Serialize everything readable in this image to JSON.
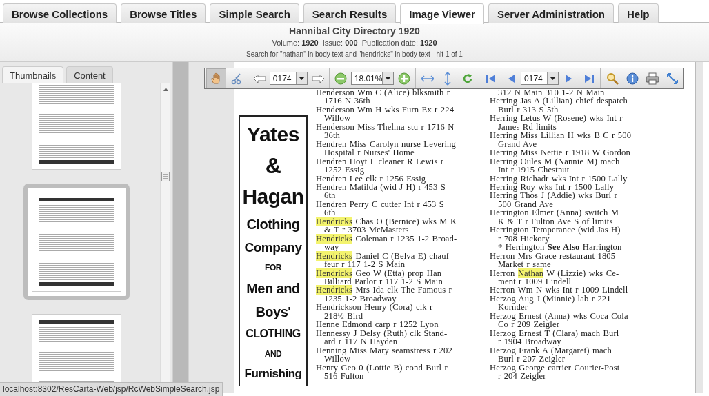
{
  "tabs": [
    {
      "label": "Browse Collections",
      "selected": false
    },
    {
      "label": "Browse Titles",
      "selected": false
    },
    {
      "label": "Simple Search",
      "selected": false
    },
    {
      "label": "Search Results",
      "selected": false
    },
    {
      "label": "Image Viewer",
      "selected": true
    },
    {
      "label": "Server Administration",
      "selected": false
    },
    {
      "label": "Help",
      "selected": false
    }
  ],
  "header": {
    "title": "Hannibal City Directory 1920",
    "meta": "Volume: **1920**  Issue: **000**  Publication date: **1920**",
    "search": "Search for \"nathan\" in body text and \"hendricks\" in body text - hit 1 of 1"
  },
  "side_tabs": [
    {
      "label": "Thumbnails",
      "selected": true
    },
    {
      "label": "Content",
      "selected": false
    }
  ],
  "thumbnails": [
    {
      "selected": false
    },
    {
      "selected": true
    },
    {
      "selected": false
    }
  ],
  "toolbar": [
    {
      "kind": "tool",
      "pressed": true
    },
    {
      "kind": "tool",
      "pressed": false
    },
    {
      "kind": "separator"
    },
    {
      "kind": "tool",
      "pressed": false
    },
    {
      "kind": "select",
      "value": "0174"
    },
    {
      "kind": "tool",
      "pressed": false
    },
    {
      "kind": "separator"
    },
    {
      "kind": "tool",
      "pressed": false
    },
    {
      "kind": "select",
      "value": "18.01%"
    },
    {
      "kind": "tool",
      "pressed": false
    },
    {
      "kind": "separator"
    },
    {
      "kind": "tool",
      "pressed": false
    },
    {
      "kind": "tool",
      "pressed": false
    },
    {
      "kind": "tool",
      "pressed": false
    },
    {
      "kind": "separator"
    },
    {
      "kind": "tool",
      "pressed": false
    },
    {
      "kind": "tool",
      "pressed": false
    },
    {
      "kind": "select",
      "value": "0174"
    },
    {
      "kind": "tool",
      "pressed": false
    },
    {
      "kind": "tool",
      "pressed": false
    },
    {
      "kind": "separator"
    },
    {
      "kind": "tool",
      "pressed": false
    },
    {
      "kind": "tool",
      "pressed": false
    },
    {
      "kind": "tool",
      "pressed": false
    },
    {
      "kind": "tool",
      "pressed": false
    }
  ],
  "document": {
    "advert": [
      "Yates",
      "&",
      "Hagan",
      "Clothing",
      "Company",
      "FOR",
      "Men and",
      "Boys'",
      "CLOTHING",
      "AND",
      "Furnishing"
    ],
    "column_1": [
      {
        "continued": false,
        "head": [
          {
            "text": "Henderson Wm C (Alice) blksmith r",
            "highlighted": false
          }
        ],
        "lines": [
          "1716 N 36th"
        ]
      },
      {
        "continued": false,
        "head": [
          {
            "text": "Henderson Wm H wks Furn Ex r 224",
            "highlighted": false
          }
        ],
        "lines": [
          "Willow"
        ]
      },
      {
        "continued": false,
        "head": [
          {
            "text": "Henderson Miss Thelma stu r 1716 N",
            "highlighted": false
          }
        ],
        "lines": [
          "36th"
        ]
      },
      {
        "continued": false,
        "head": [
          {
            "text": "Hendren Miss Carolyn nurse Levering",
            "highlighted": false
          }
        ],
        "lines": [
          "Hospital r Nurses' Home"
        ]
      },
      {
        "continued": false,
        "head": [
          {
            "text": "Hendren Hoyt L cleaner R Lewis r",
            "highlighted": false
          }
        ],
        "lines": [
          "1252 Essig"
        ]
      },
      {
        "continued": false,
        "head": [
          {
            "text": "Hendren Lee clk r 1256 Essig",
            "highlighted": false
          }
        ]
      },
      {
        "continued": false,
        "head": [
          {
            "text": "Hendren Matilda (wid J H) r 453 S",
            "highlighted": false
          }
        ],
        "lines": [
          "6th"
        ]
      },
      {
        "continued": false,
        "head": [
          {
            "text": "Hendren Perry C cutter Int r 453 S",
            "highlighted": false
          }
        ],
        "lines": [
          "6th"
        ]
      },
      {
        "continued": false,
        "head": [
          {
            "text": "Hendricks",
            "highlighted": true
          },
          {
            "text": " Chas O (Bernice) wks M K",
            "highlighted": false
          }
        ],
        "lines": [
          "& T r 3703 McMasters"
        ]
      },
      {
        "continued": false,
        "head": [
          {
            "text": "Hendricks",
            "highlighted": true
          },
          {
            "text": " Coleman r 1235 1-2 Broad-",
            "highlighted": false
          }
        ],
        "lines": [
          "way"
        ]
      },
      {
        "continued": false,
        "head": [
          {
            "text": "Hendricks",
            "highlighted": true
          },
          {
            "text": " Daniel C (Belva E) chauf-",
            "highlighted": false
          }
        ],
        "lines": [
          "feur r 117 1-2 S Main"
        ]
      },
      {
        "continued": false,
        "head": [
          {
            "text": "Hendricks",
            "highlighted": true
          },
          {
            "text": " Geo W (Etta) prop Han",
            "highlighted": false
          }
        ],
        "lines": [
          "Billiard Parlor r 117 1-2 S Main"
        ]
      },
      {
        "continued": false,
        "head": [
          {
            "text": "Hendricks",
            "highlighted": true
          },
          {
            "text": " Mrs Ida clk The Famous r",
            "highlighted": false
          }
        ],
        "lines": [
          "1235 1-2 Broadway"
        ]
      },
      {
        "continued": false,
        "head": [
          {
            "text": "Hendrickson Henry (Cora) clk r",
            "highlighted": false
          }
        ],
        "lines": [
          "218½ Bird"
        ]
      },
      {
        "continued": false,
        "head": [
          {
            "text": "Henne Edmond carp r 1252 Lyon",
            "highlighted": false
          }
        ]
      },
      {
        "continued": false,
        "head": [
          {
            "text": "Hennessy J Delsy (Ruth) clk Stand-",
            "highlighted": false
          }
        ],
        "lines": [
          "ard r 117 N Hayden"
        ]
      },
      {
        "continued": false,
        "head": [
          {
            "text": "Henning Miss Mary seamstress r 202",
            "highlighted": false
          }
        ],
        "lines": [
          "Willow"
        ]
      },
      {
        "continued": false,
        "head": [
          {
            "text": "Henry Geo 0 (Lottie B) cond Burl r",
            "highlighted": false
          }
        ],
        "lines": [
          "516 Fulton"
        ]
      }
    ],
    "column_2": [
      {
        "continued": true,
        "head": [
          {
            "text": "312 N Main 310 1-2 N Main",
            "highlighted": false
          }
        ]
      },
      {
        "continued": false,
        "head": [
          {
            "text": "Herring Jas A (Lillian) chief despatch",
            "highlighted": false
          }
        ],
        "lines": [
          "Burl r 313 S 5th"
        ]
      },
      {
        "continued": false,
        "head": [
          {
            "text": "Herring Letus W (Rosene) wks Int r",
            "highlighted": false
          }
        ],
        "lines": [
          "James Rd limits"
        ]
      },
      {
        "continued": false,
        "head": [
          {
            "text": "Herring Miss Lillian H wks B C r 500",
            "highlighted": false
          }
        ],
        "lines": [
          "Grand Ave"
        ]
      },
      {
        "continued": false,
        "head": [
          {
            "text": "Herring Miss Nettie r 1918 W Gordon",
            "highlighted": false
          }
        ]
      },
      {
        "continued": false,
        "head": [
          {
            "text": "Herring Oules M (Nannie M) mach",
            "highlighted": false
          }
        ],
        "lines": [
          "Int r 1915 Chestnut"
        ]
      },
      {
        "continued": false,
        "head": [
          {
            "text": "Herring Richadr wks Int r 1500 Lally",
            "highlighted": false
          }
        ]
      },
      {
        "continued": false,
        "head": [
          {
            "text": "Herring Roy wks Int r 1500 Lally",
            "highlighted": false
          }
        ]
      },
      {
        "continued": false,
        "head": [
          {
            "text": "Herring Thos J (Addie) wks Burl r",
            "highlighted": false
          }
        ],
        "lines": [
          "500 Grand Ave"
        ]
      },
      {
        "continued": false,
        "head": [
          {
            "text": "Herrington Elmer (Anna) switch M",
            "highlighted": false
          }
        ],
        "lines": [
          "K & T r Fulton Ave S of limits"
        ]
      },
      {
        "continued": false,
        "head": [
          {
            "text": "Herrington Temperance (wid Jas H)",
            "highlighted": false
          }
        ],
        "lines": [
          "r 708 Hickory"
        ]
      },
      {
        "continued": true,
        "head": [
          {
            "text": "*  Herrington **See Also** Harrington",
            "highlighted": false
          }
        ]
      },
      {
        "continued": false,
        "head": [
          {
            "text": "Herron Mrs Grace restaurant 1805",
            "highlighted": false
          }
        ],
        "lines": [
          "Market r same"
        ]
      },
      {
        "continued": false,
        "head": [
          {
            "text": "Herron ",
            "highlighted": false
          },
          {
            "text": "Nathan",
            "highlighted": true
          },
          {
            "text": " W (Lizzie) wks Ce-",
            "highlighted": false
          }
        ],
        "lines": [
          "ment r 1009 Lindell"
        ]
      },
      {
        "continued": false,
        "head": [
          {
            "text": "Herron Wm N wks Int r 1009 Lindell",
            "highlighted": false
          }
        ]
      },
      {
        "continued": false,
        "head": [
          {
            "text": "Herzog Aug J (Minnie) lab r 221",
            "highlighted": false
          }
        ],
        "lines": [
          "Kornder"
        ]
      },
      {
        "continued": false,
        "head": [
          {
            "text": "Herzog Ernest (Anna) wks Coca Cola",
            "highlighted": false
          }
        ],
        "lines": [
          "Co r 209 Zeigler"
        ]
      },
      {
        "continued": false,
        "head": [
          {
            "text": "Herzog Ernest T (Clara) mach Burl",
            "highlighted": false
          }
        ],
        "lines": [
          "r 1904 Broadway"
        ]
      },
      {
        "continued": false,
        "head": [
          {
            "text": "Herzog Frank A (Margaret) mach",
            "highlighted": false
          }
        ],
        "lines": [
          "Burl r 207 Zeigler"
        ]
      },
      {
        "continued": false,
        "head": [
          {
            "text": "Herzog George carrier Courier-Post",
            "highlighted": false
          }
        ],
        "lines": [
          "r 204 Zeigler"
        ]
      }
    ]
  },
  "status_bar": "localhost:8302/ResCarta-Web/jsp/RcWebSimpleSearch.jsp"
}
